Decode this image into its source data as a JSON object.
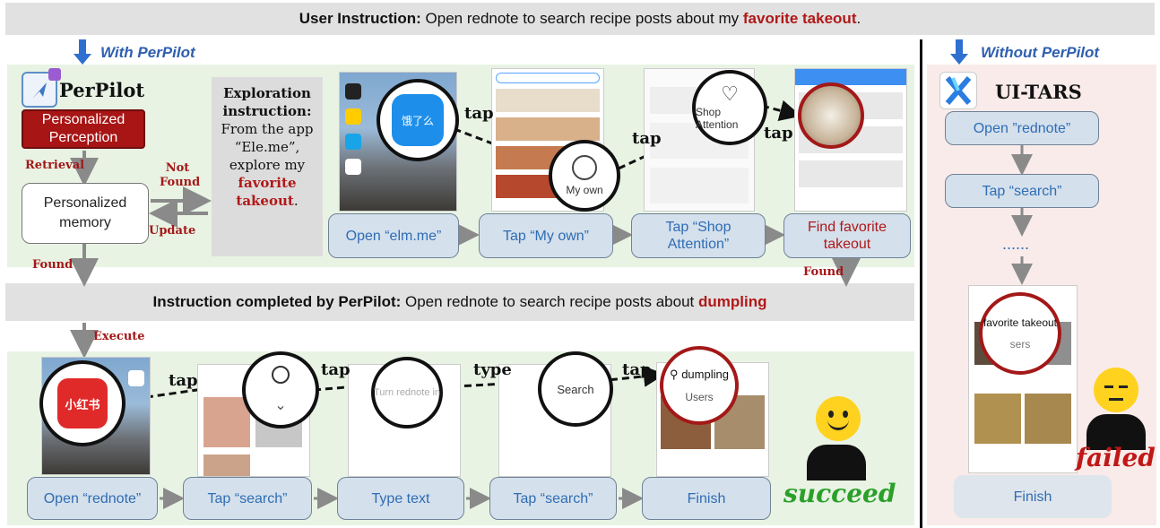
{
  "top_bar": {
    "prefix": "User Instruction:",
    "text": " Open rednote to search recipe posts about my ",
    "highlight": "favorite takeout",
    "suffix": "."
  },
  "with_label": "With PerPilot",
  "without_label": "Without PerPilot",
  "perpilot": {
    "title": "PerPilot",
    "perception": "Personalized Perception",
    "memory": "Personalized memory",
    "retrieval": "Retrieval",
    "not_found": "Not Found",
    "update": "Update",
    "found": "Found",
    "execute": "Execute"
  },
  "exploration": {
    "title": "Exploration instruction:",
    "line1": "From the app",
    "line2": "“Ele.me”,",
    "line3": "explore my",
    "highlight1": "favorite",
    "highlight2": "takeout",
    "suffix": "."
  },
  "explore_steps": [
    "Open “elm.me”",
    "Tap “My own”",
    "Tap “Shop Attention”",
    "Find favorite takeout"
  ],
  "explore_found": "Found",
  "tap_labels": [
    "tap",
    "tap",
    "tap"
  ],
  "circle_labels": {
    "my_own": "My own",
    "shop_attention": "Shop Attention",
    "elm_app": "饿了么"
  },
  "mid_bar": {
    "prefix": "Instruction completed by PerPilot:",
    "text": " Open rednote to search recipe posts about ",
    "highlight": "dumpling"
  },
  "bottom_steps": [
    "Open “rednote”",
    "Tap “search”",
    "Type text",
    "Tap “search”",
    "Finish"
  ],
  "bottom_actions": [
    "tap",
    "tap",
    "type",
    "tap"
  ],
  "bottom_circles": {
    "rednote_app": "小红书",
    "search": "Search",
    "dumpling": "dumpling",
    "users": "Users",
    "type_field": "Turn rednote in"
  },
  "succeed": "succeed",
  "uitars": {
    "title": "UI-TARS",
    "steps": [
      "Open ”rednote”",
      "Tap “search”",
      "......",
      "Finish"
    ],
    "circle_text": "favorite takeout",
    "circle_sub": "sers",
    "failed": "failed"
  },
  "colors": {
    "accent_red": "#a31818",
    "step_blue": "#2f6db4",
    "panel_green": "#e8f3e4",
    "panel_pink": "#f9ebe9"
  }
}
